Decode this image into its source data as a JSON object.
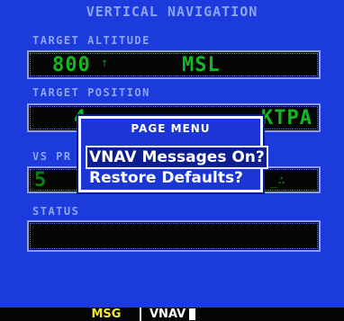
{
  "page": {
    "title": "VERTICAL NAVIGATION"
  },
  "target_altitude": {
    "label": "TARGET ALTITUDE",
    "value": "800",
    "reference": "MSL"
  },
  "target_position": {
    "label": "TARGET POSITION",
    "value_partial": "4",
    "waypoint_partial": "KTPA"
  },
  "vs_profile": {
    "label": "VS PR",
    "value_partial": "5"
  },
  "status": {
    "label": "STATUS",
    "value": ""
  },
  "page_menu": {
    "title": "PAGE MENU",
    "items": [
      {
        "label": "VNAV Messages On?",
        "selected": true
      },
      {
        "label": "Restore Defaults?",
        "selected": false
      }
    ]
  },
  "status_bar": {
    "msg": "MSG",
    "page": "VNAV"
  },
  "colors": {
    "background": "#1b3bdc",
    "label": "#8ea3f2",
    "field_text": "#12b822",
    "msg_text": "#f2e82a",
    "popup_border": "#ffffff"
  }
}
